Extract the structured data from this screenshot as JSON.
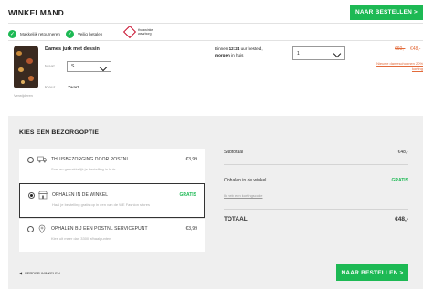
{
  "header": {
    "title": "WINKELMAND",
    "checkout_label": "NAAR BESTELLEN >"
  },
  "usps": [
    {
      "label": "Makkelijk retourneren",
      "icon": "check-icon"
    },
    {
      "label": "Veilig betalen",
      "icon": "check-icon"
    }
  ],
  "trustmark": {
    "line1": "thuiswinkel",
    "line2": "waarborg"
  },
  "product": {
    "name": "Dames jurk met dessin",
    "remove_label": "Verwijderen",
    "size_label": "Maat",
    "size_value": "S",
    "color_label": "Kleur",
    "color_value": "Zwart",
    "delivery_pre": "Binnen ",
    "delivery_time": "12:24",
    "delivery_mid": " uur besteld,",
    "delivery_day": "morgen",
    "delivery_post": " in huis",
    "quantity": "1",
    "old_price": "€60,-",
    "new_price": "€48,-",
    "promo": "Nieuwe dameschoenen 20% korting"
  },
  "shipping": {
    "title": "KIES EEN BEZORGOPTIE",
    "options": [
      {
        "name": "THUISBEZORGING DOOR POSTNL",
        "desc": "Snel en gemakkelijk je bestelling in huis",
        "price": "€3,99",
        "selected": false,
        "icon": "truck-icon"
      },
      {
        "name": "OPHALEN IN DE WINKEL",
        "desc": "Haal je bestelling gratis op in een van de WE Fashion stores",
        "price": "GRATIS",
        "selected": true,
        "icon": "store-icon"
      },
      {
        "name": "OPHALEN BIJ EEN POSTNL SERVICEPUNT",
        "desc": "Kies uit meer dan 3300 afhaalpunten",
        "price": "€3,99",
        "selected": false,
        "icon": "location-pin-icon"
      }
    ]
  },
  "summary": {
    "subtotal_label": "Subtotaal",
    "subtotal_value": "€48,-",
    "pickup_label": "Ophalen in de winkel",
    "pickup_value": "GRATIS",
    "code_link": "Ik heb een kortingscode",
    "total_label": "TOTAAL",
    "total_value": "€48,-"
  },
  "footer": {
    "continue_label": "VERDER WINKELEN",
    "checkout_label": "NAAR BESTELLEN >"
  },
  "colors": {
    "green": "#1db954",
    "orange": "#e26a3a",
    "panel": "#efefef"
  }
}
